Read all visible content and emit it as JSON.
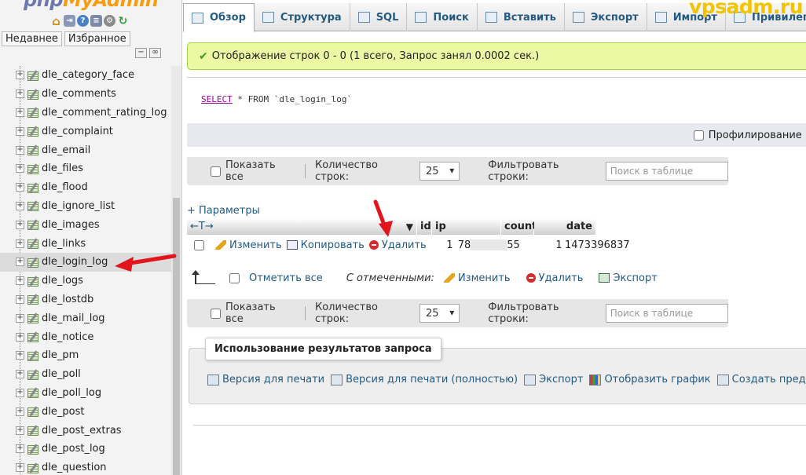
{
  "sidebar": {
    "logo_main": "php",
    "logo_accent": "MyAdmin",
    "recent_button": "Недавнее",
    "favorites_button": "Избранное",
    "tables": [
      "dle_category_face",
      "dle_comments",
      "dle_comment_rating_log",
      "dle_complaint",
      "dle_email",
      "dle_files",
      "dle_flood",
      "dle_ignore_list",
      "dle_images",
      "dle_links",
      "dle_login_log",
      "dle_logs",
      "dle_lostdb",
      "dle_mail_log",
      "dle_notice",
      "dle_pm",
      "dle_poll",
      "dle_poll_log",
      "dle_post",
      "dle_post_extras",
      "dle_post_log",
      "dle_question"
    ],
    "active_table": "dle_login_log"
  },
  "tabs": [
    "Обзор",
    "Структура",
    "SQL",
    "Поиск",
    "Вставить",
    "Экспорт",
    "Импорт",
    "Привилегии"
  ],
  "active_tab": "Обзор",
  "watermark": "vpsadm.ru",
  "message": {
    "text": "Отображение строк 0 - 0 (1 всего, Запрос занял 0.0002 сек.)"
  },
  "sql": {
    "keyword_select": "SELECT",
    "rest": " * FROM `dle_login_log`"
  },
  "profiling_label": "Профилирование [",
  "nav": {
    "show_all": "Показать все",
    "rows_label": "Количество строк:",
    "rows_value": "25",
    "filter_label": "Фильтровать строки:",
    "filter_placeholder": "Поиск в таблице"
  },
  "params_link": "+ Параметры",
  "table": {
    "headers": [
      "id",
      "ip",
      "count",
      "date"
    ],
    "actions": {
      "edit": "Изменить",
      "copy": "Копировать",
      "delete": "Удалить"
    },
    "row": {
      "id": "1",
      "ip_start": "78",
      "ip_end": "55",
      "count": "1",
      "date": "1473396837"
    }
  },
  "with_selected": {
    "check_all": "Отметить все",
    "label": "С отмеченными:",
    "edit": "Изменить",
    "delete": "Удалить",
    "export": "Экспорт"
  },
  "query_results": {
    "legend": "Использование результатов запроса",
    "print": "Версия для печати",
    "print_full": "Версия для печати (полностью)",
    "export": "Экспорт",
    "chart": "Отобразить график",
    "view": "Создать представление"
  }
}
